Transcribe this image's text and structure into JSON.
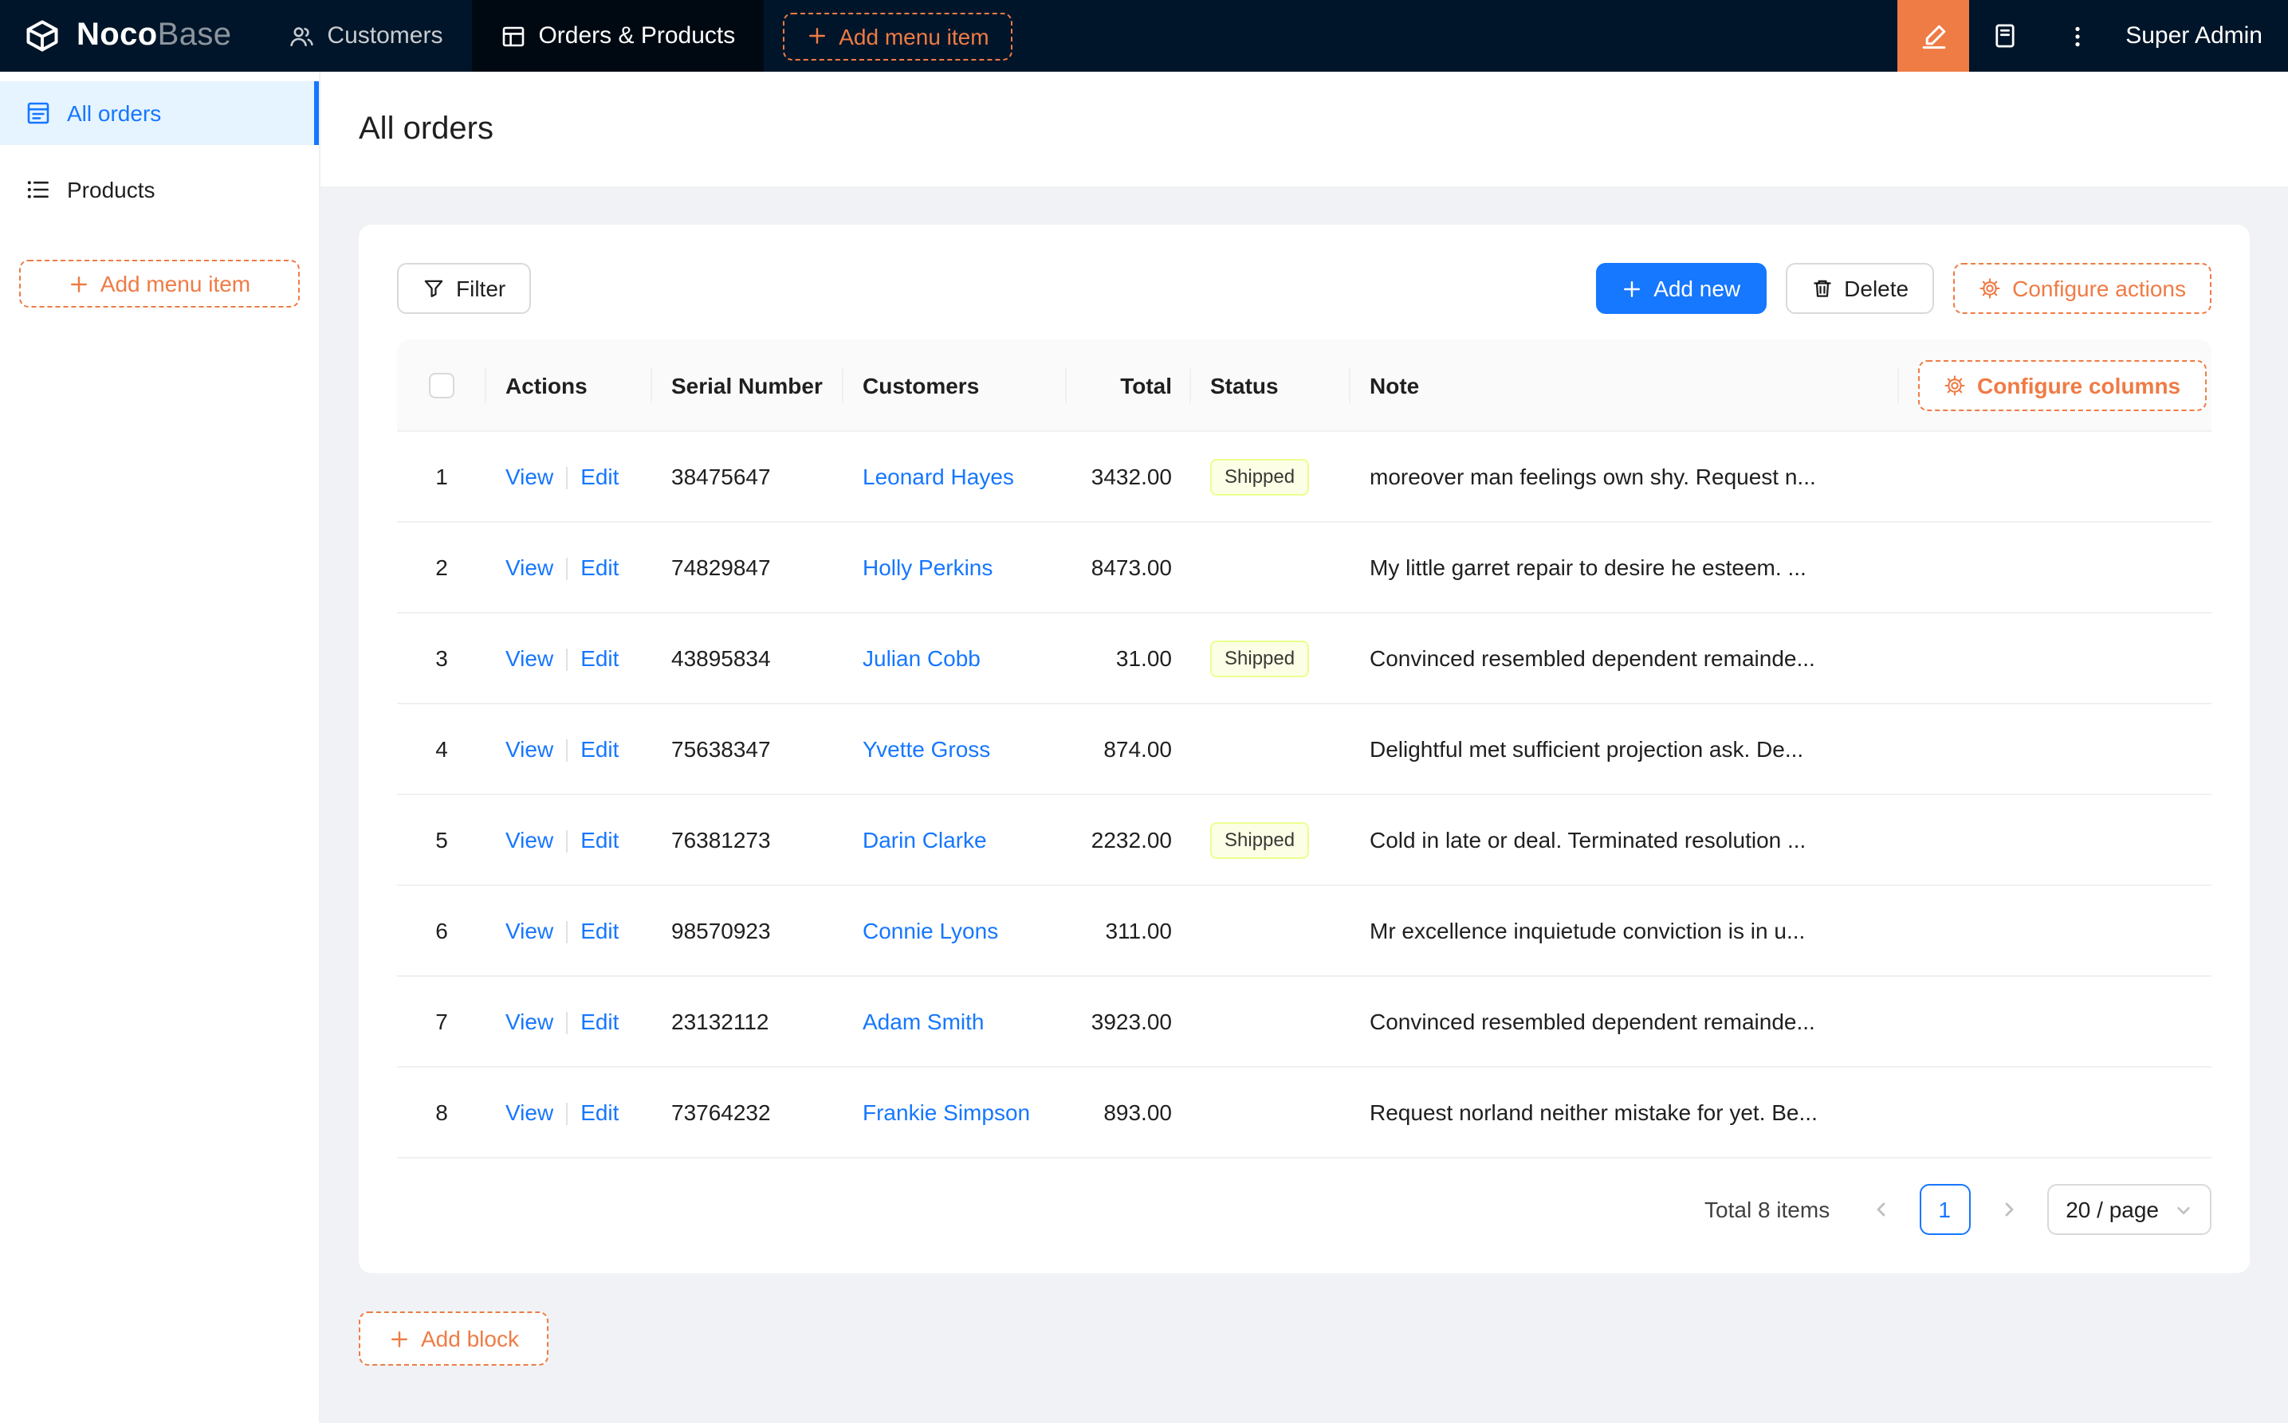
{
  "topbar": {
    "logo": {
      "name_bold": "Noco",
      "name_light": "Base"
    },
    "menu": [
      {
        "label": "Customers",
        "icon": "users-icon",
        "active": false
      },
      {
        "label": "Orders & Products",
        "icon": "table-icon",
        "active": true
      }
    ],
    "add_menu_item_label": "Add menu item",
    "user": "Super Admin"
  },
  "sidebar": {
    "items": [
      {
        "label": "All orders",
        "icon": "form-icon",
        "active": true
      },
      {
        "label": "Products",
        "icon": "list-icon",
        "active": false
      }
    ],
    "add_menu_item_label": "Add menu item"
  },
  "page": {
    "title": "All orders"
  },
  "toolbar": {
    "filter_label": "Filter",
    "add_new_label": "Add new",
    "delete_label": "Delete",
    "configure_actions_label": "Configure actions"
  },
  "table": {
    "configure_columns_label": "Configure columns",
    "columns": [
      "Actions",
      "Serial Number",
      "Customers",
      "Total",
      "Status",
      "Note"
    ],
    "actions": {
      "view": "View",
      "edit": "Edit"
    },
    "rows": [
      {
        "index": 1,
        "serial": "38475647",
        "customer": "Leonard Hayes",
        "total": "3432.00",
        "status": "Shipped",
        "note": "moreover man feelings own shy. Request n..."
      },
      {
        "index": 2,
        "serial": "74829847",
        "customer": "Holly Perkins",
        "total": "8473.00",
        "status": "",
        "note": "My little garret repair to desire he esteem. ..."
      },
      {
        "index": 3,
        "serial": "43895834",
        "customer": "Julian Cobb",
        "total": "31.00",
        "status": "Shipped",
        "note": "Convinced resembled dependent remainde..."
      },
      {
        "index": 4,
        "serial": "75638347",
        "customer": "Yvette Gross",
        "total": "874.00",
        "status": "",
        "note": "Delightful met sufficient projection ask. De..."
      },
      {
        "index": 5,
        "serial": "76381273",
        "customer": "Darin Clarke",
        "total": "2232.00",
        "status": "Shipped",
        "note": "Cold in late or deal. Terminated resolution ..."
      },
      {
        "index": 6,
        "serial": "98570923",
        "customer": "Connie Lyons",
        "total": "311.00",
        "status": "",
        "note": "Mr excellence inquietude conviction is in u..."
      },
      {
        "index": 7,
        "serial": "23132112",
        "customer": "Adam Smith",
        "total": "3923.00",
        "status": "",
        "note": "Convinced resembled dependent remainde..."
      },
      {
        "index": 8,
        "serial": "73764232",
        "customer": "Frankie Simpson",
        "total": "893.00",
        "status": "",
        "note": "Request norland neither mistake for yet. Be..."
      }
    ]
  },
  "pagination": {
    "total_text": "Total 8 items",
    "current_page": "1",
    "page_size": "20 / page"
  },
  "add_block_label": "Add block",
  "colors": {
    "primary_blue": "#1677ff",
    "accent_orange": "#EF7B45",
    "topbar_bg": "#001529",
    "sidebar_active_bg": "#e6f4ff",
    "status_shipped_bg": "#fcffe6",
    "status_shipped_border": "#eaff8f",
    "table_header_bg": "#fafafa",
    "page_bg": "#f0f2f5"
  },
  "icons": {
    "logo": "nocobase-logo-icon",
    "customers_menu": "users-icon",
    "orders_menu": "table-icon",
    "add": "plus-icon",
    "ui_editor": "brush-icon",
    "docs": "notebook-icon",
    "more": "ellipsis-vertical-icon",
    "all_orders": "form-icon",
    "products": "list-icon",
    "filter": "filter-icon",
    "delete": "trash-icon",
    "configure": "gear-icon",
    "pagination_prev": "chevron-left-icon",
    "pagination_next": "chevron-right-icon",
    "select_caret": "chevron-down-icon"
  }
}
